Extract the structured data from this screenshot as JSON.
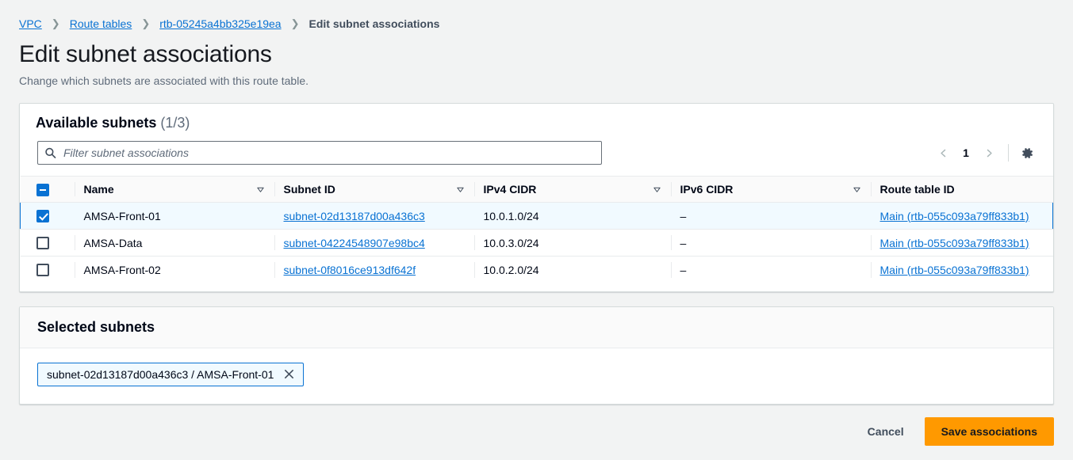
{
  "breadcrumb": {
    "items": [
      {
        "label": "VPC",
        "type": "link"
      },
      {
        "label": "Route tables",
        "type": "link"
      },
      {
        "label": "rtb-05245a4bb325e19ea",
        "type": "link"
      },
      {
        "label": "Edit subnet associations",
        "type": "current"
      }
    ],
    "separator": "❯"
  },
  "page": {
    "title": "Edit subnet associations",
    "description": "Change which subnets are associated with this route table."
  },
  "available": {
    "title": "Available subnets",
    "counter": "(1/3)",
    "filter": {
      "placeholder": "Filter subnet associations",
      "value": ""
    },
    "pagination": {
      "prev_icon": "chevron-left-icon",
      "page": "1",
      "next_icon": "chevron-right-icon"
    },
    "settings_icon": "gear-icon",
    "columns": [
      {
        "label": "Name",
        "sortable": true
      },
      {
        "label": "Subnet ID",
        "sortable": true
      },
      {
        "label": "IPv4 CIDR",
        "sortable": true
      },
      {
        "label": "IPv6 CIDR",
        "sortable": true
      },
      {
        "label": "Route table ID",
        "sortable": false
      }
    ],
    "select_all_state": "indeterminate",
    "rows": [
      {
        "selected": true,
        "name": "AMSA-Front-01",
        "subnet_id": "subnet-02d13187d00a436c3",
        "ipv4_cidr": "10.0.1.0/24",
        "ipv6_cidr": "–",
        "route_table_id": "Main (rtb-055c093a79ff833b1)"
      },
      {
        "selected": false,
        "name": "AMSA-Data",
        "subnet_id": "subnet-04224548907e98bc4",
        "ipv4_cidr": "10.0.3.0/24",
        "ipv6_cidr": "–",
        "route_table_id": "Main (rtb-055c093a79ff833b1)"
      },
      {
        "selected": false,
        "name": "AMSA-Front-02",
        "subnet_id": "subnet-0f8016ce913df642f",
        "ipv4_cidr": "10.0.2.0/24",
        "ipv6_cidr": "–",
        "route_table_id": "Main (rtb-055c093a79ff833b1)"
      }
    ]
  },
  "selected_panel": {
    "title": "Selected subnets",
    "tokens": [
      {
        "label": "subnet-02d13187d00a436c3 / AMSA-Front-01",
        "dismiss_icon": "close-icon"
      }
    ]
  },
  "footer": {
    "cancel_label": "Cancel",
    "save_label": "Save associations"
  },
  "colors": {
    "link": "#0972d3",
    "primary_button": "#ff9900",
    "selected_row_bg": "#f1faff",
    "page_bg": "#f2f3f3"
  }
}
